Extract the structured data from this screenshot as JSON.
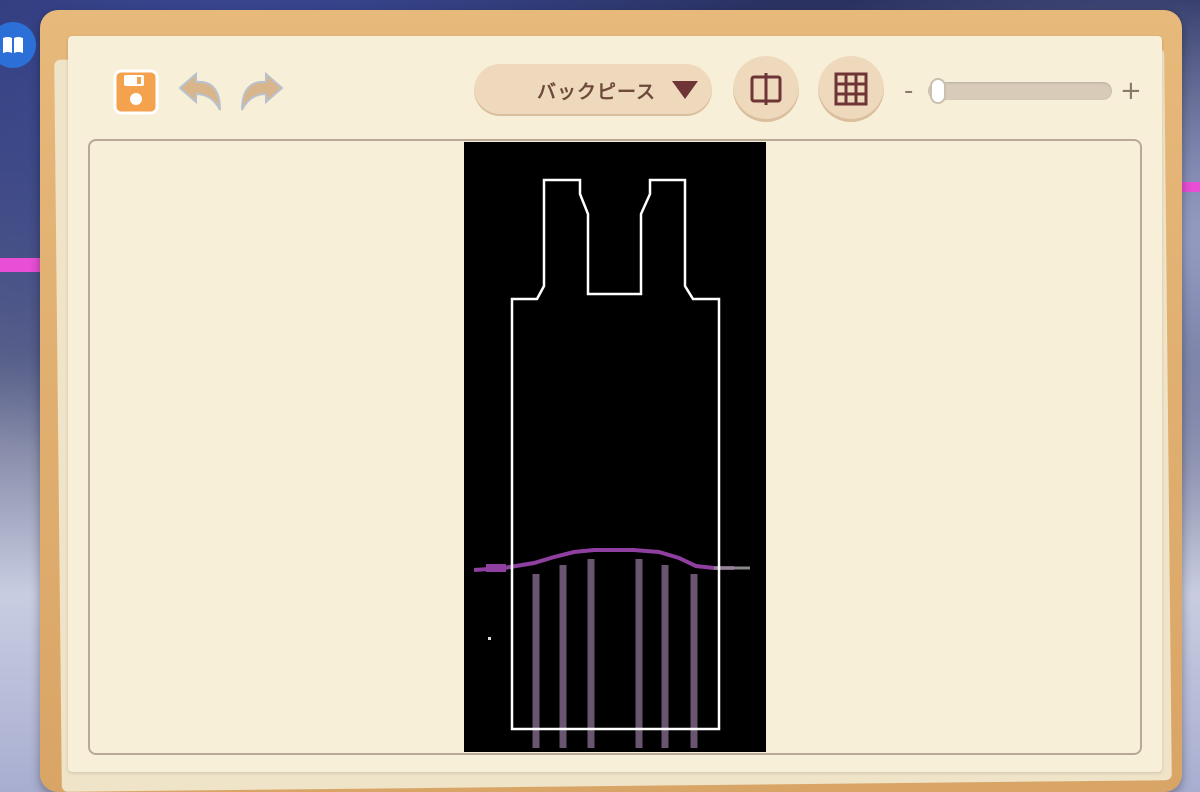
{
  "toolbar": {
    "save_icon": "floppy-disk-icon",
    "undo_icon": "undo-arrow-icon",
    "redo_icon": "redo-arrow-icon",
    "piece_select": {
      "selected": "バックピース"
    },
    "mirror_icon": "mirror-symmetry-icon",
    "grid_icon": "grid-icon",
    "zoom": {
      "minus_label": "-",
      "plus_label": "+",
      "level": 0.0
    }
  },
  "side_badge_icon": "book-icon",
  "colors": {
    "frame": "#e2b072",
    "paper": "#f8efd9",
    "button": "#eed9bd",
    "icon_brown": "#6e4a3a",
    "save_orange": "#f4a24e",
    "canvas": "#000000",
    "outline": "#ffffff",
    "accent_purple": "#8e3fa0",
    "stripe": "#6a5570"
  }
}
